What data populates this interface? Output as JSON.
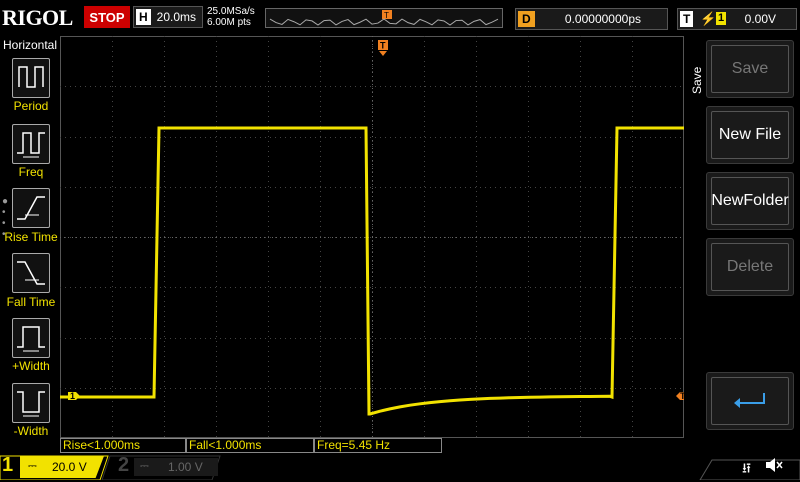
{
  "brand": "RIGOL",
  "run_state": "STOP",
  "horizontal": {
    "letter": "H",
    "timebase": "20.0ms",
    "sample_rate": "25.0MSa/s",
    "memory_depth": "6.00M pts"
  },
  "delay": {
    "letter": "D",
    "value": "0.00000000ps"
  },
  "trigger": {
    "letter": "T",
    "edge_icon": "rising-edge",
    "channel": "1",
    "level": "0.00V"
  },
  "left_menu": {
    "title": "Horizontal",
    "items": [
      {
        "label": "Period"
      },
      {
        "label": "Freq"
      },
      {
        "label": "Rise Time"
      },
      {
        "label": "Fall Time"
      },
      {
        "label": "+Width"
      },
      {
        "label": "-Width"
      }
    ]
  },
  "right_menu": {
    "title": "Save",
    "buttons": [
      {
        "label": "Save",
        "enabled": false
      },
      {
        "label": "New File",
        "enabled": true
      },
      {
        "label": "NewFolder",
        "enabled": true
      },
      {
        "label": "Delete",
        "enabled": false
      }
    ],
    "enter_icon": "enter-return-icon"
  },
  "measurements": [
    {
      "label": "Rise<1.000ms"
    },
    {
      "label": "Fall<1.000ms"
    },
    {
      "label": "Freq=5.45 Hz"
    }
  ],
  "channels": [
    {
      "number": "1",
      "scale": "20.0 V",
      "color": "#f2e200",
      "active": true
    },
    {
      "number": "2",
      "scale": "1.00 V",
      "color": "#555555",
      "active": false
    }
  ],
  "markers": {
    "channel_marker": "1",
    "trigger_marker": "T"
  },
  "status_icons": [
    "usb-icon",
    "speaker-mute-icon"
  ],
  "colors": {
    "trace": "#f2e200",
    "stop": "#cc0000",
    "trigger_marker": "#f08020"
  }
}
